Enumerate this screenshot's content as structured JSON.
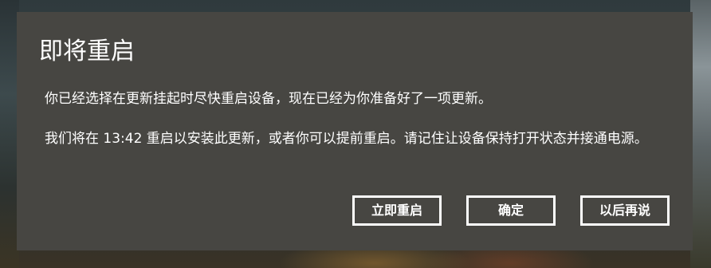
{
  "dialog": {
    "title": "即将重启",
    "message_line1": "你已经选择在更新挂起时尽快重启设备，现在已经为你准备好了一项更新。",
    "message_line2": "我们将在 13:42 重启以安装此更新，或者你可以提前重启。请记住让设备保持打开状态并接通电源。",
    "buttons": {
      "restart_now": "立即重启",
      "ok": "确定",
      "later": "以后再说"
    }
  },
  "colors": {
    "dialog_background": "#474642",
    "text": "#ffffff",
    "button_border": "#ffffff"
  }
}
